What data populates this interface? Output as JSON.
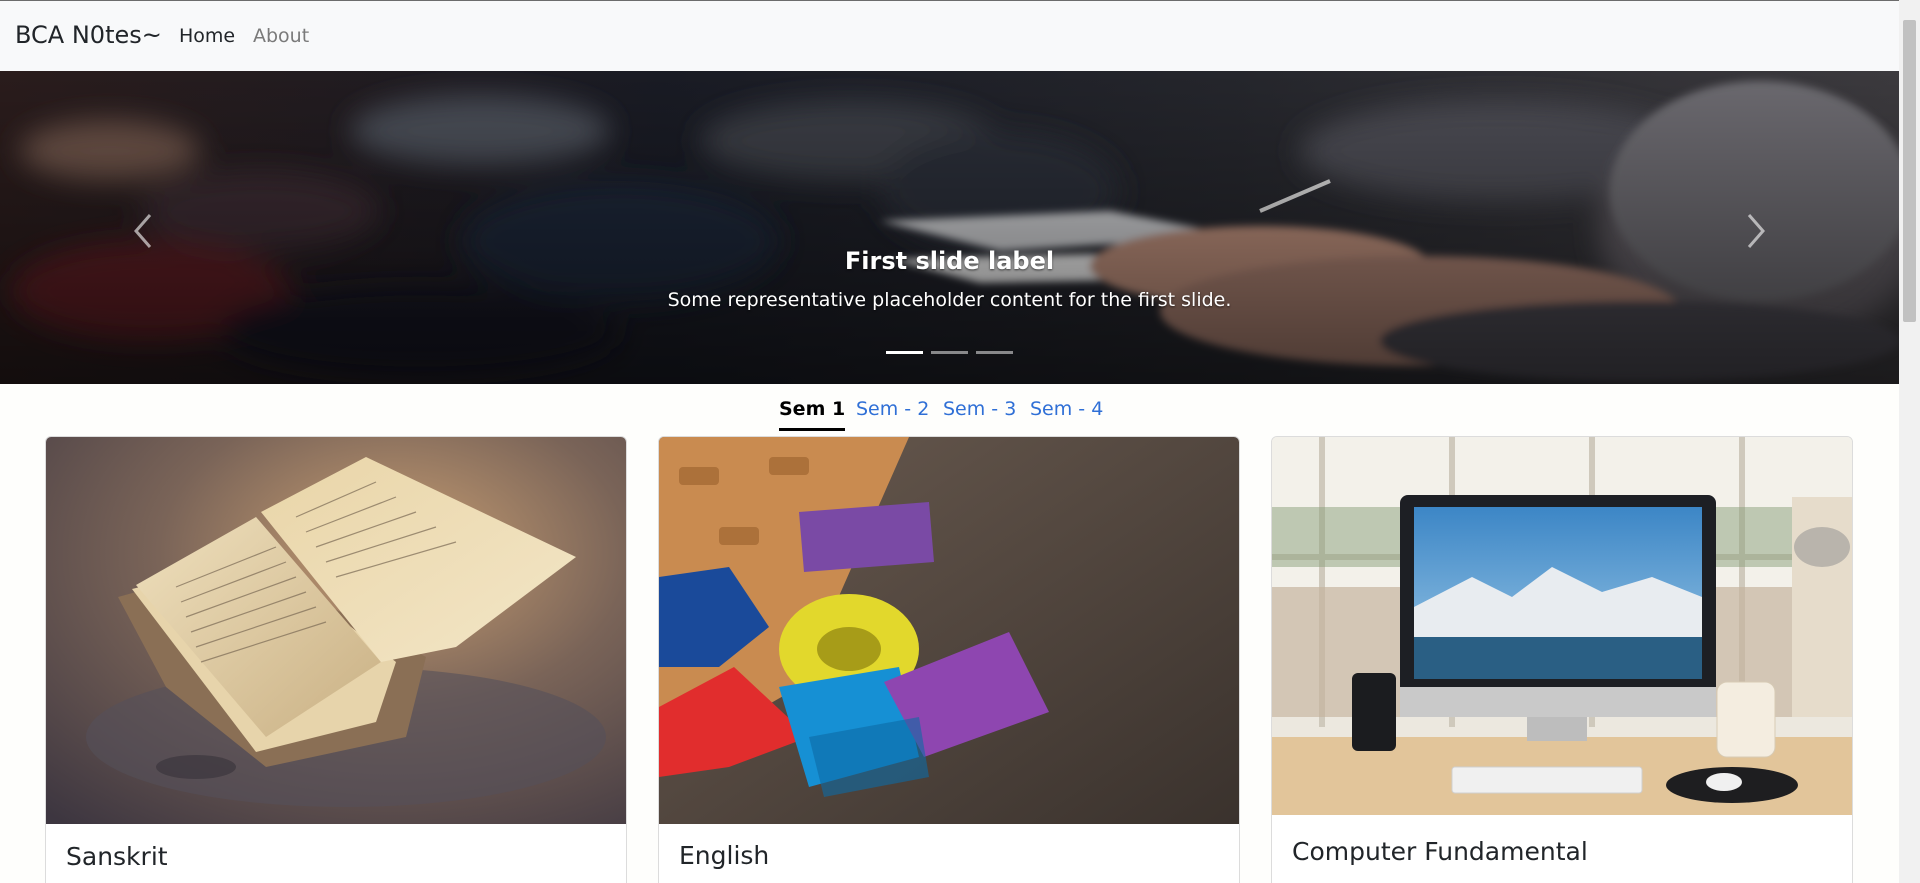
{
  "navbar": {
    "brand": "BCA N0tes~",
    "links": [
      {
        "label": "Home",
        "active": true
      },
      {
        "label": "About",
        "active": false
      }
    ]
  },
  "carousel": {
    "caption_title": "First slide label",
    "caption_text": "Some representative placeholder content for the first slide.",
    "slide_count": 3,
    "active_slide": 1,
    "prev_icon": "chevron-left-icon",
    "next_icon": "chevron-right-icon"
  },
  "tabs": [
    {
      "label": "Sem 1",
      "active": true
    },
    {
      "label": "Sem - 2",
      "active": false
    },
    {
      "label": "Sem - 3",
      "active": false
    },
    {
      "label": "Sem - 4",
      "active": false
    }
  ],
  "cards": [
    {
      "title": "Sanskrit",
      "image": "open-book-photo"
    },
    {
      "title": "English",
      "image": "alphabet-blocks-photo"
    },
    {
      "title": "Computer Fundamental",
      "image": "desktop-computer-photo"
    }
  ],
  "colors": {
    "navbar_bg": "#f8f9fa",
    "tab_link": "#2f6fd6",
    "tab_active": "#000000",
    "page_bg": "#fefefc"
  }
}
